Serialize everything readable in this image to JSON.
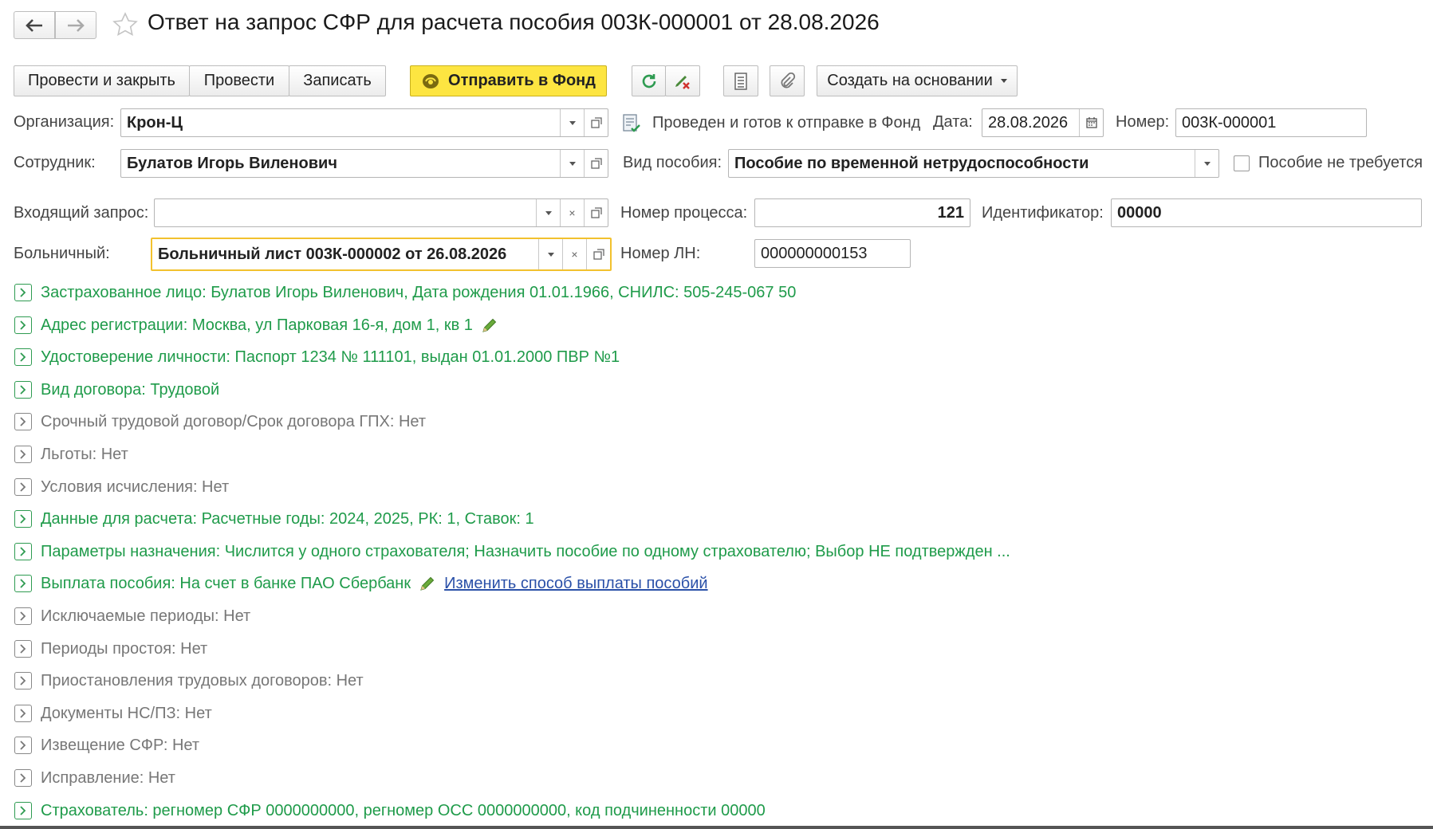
{
  "title": "Ответ на запрос СФР для расчета пособия 003К-000001 от 28.08.2026",
  "toolbar": {
    "post_close": "Провести и закрыть",
    "post": "Провести",
    "write": "Записать",
    "send": "Отправить в Фонд",
    "create_based": "Создать на основании"
  },
  "form": {
    "org_label": "Организация:",
    "org_value": "Крон-Ц",
    "status_text": "Проведен и готов к отправке в Фонд",
    "date_label": "Дата:",
    "date_value": "28.08.2026",
    "number_label": "Номер:",
    "number_value": "003К-000001",
    "employee_label": "Сотрудник:",
    "employee_value": "Булатов Игорь Виленович",
    "benefit_label": "Вид пособия:",
    "benefit_value": "Пособие по временной нетрудоспособности",
    "no_benefit_label": "Пособие не требуется",
    "request_label": "Входящий запрос:",
    "request_value": "",
    "process_label": "Номер процесса:",
    "process_value": "121",
    "ident_label": "Идентификатор:",
    "ident_value": "00000",
    "sick_label": "Больничный:",
    "sick_value": "Больничный лист 003К-000002 от 26.08.2026",
    "ln_label": "Номер ЛН:",
    "ln_value": "000000000153"
  },
  "sections": [
    {
      "text": "Застрахованное лицо: Булатов Игорь Виленович, Дата рождения 01.01.1966, СНИЛС: 505-245-067 50",
      "style": "green"
    },
    {
      "text": "Адрес регистрации: Москва, ул Парковая 16-я, дом 1, кв 1",
      "style": "green"
    },
    {
      "text": "Удостоверение личности: Паспорт 1234 № 111101, выдан 01.01.2000 ПВР №1",
      "style": "green"
    },
    {
      "text": "Вид договора: Трудовой",
      "style": "green"
    },
    {
      "text": "Срочный трудовой договор/Срок договора ГПХ: Нет",
      "style": "gray"
    },
    {
      "text": "Льготы: Нет",
      "style": "gray"
    },
    {
      "text": "Условия исчисления: Нет",
      "style": "gray"
    },
    {
      "text": "Данные для расчета: Расчетные годы: 2024, 2025, РК: 1, Ставок: 1",
      "style": "green"
    },
    {
      "text": "Параметры назначения: Числится у одного страхователя; Назначить пособие по одному страхователю; Выбор НЕ подтвержден ...",
      "style": "green"
    },
    {
      "text": "Выплата пособия: На счет в банке ПАО Сбербанк",
      "style": "green"
    },
    {
      "text": "Исключаемые периоды: Нет",
      "style": "gray"
    },
    {
      "text": "Периоды простоя: Нет",
      "style": "gray"
    },
    {
      "text": "Приостановления трудовых договоров: Нет",
      "style": "gray"
    },
    {
      "text": "Документы НС/ПЗ: Нет",
      "style": "gray"
    },
    {
      "text": "Извещение СФР: Нет",
      "style": "gray"
    },
    {
      "text": "Исправление: Нет",
      "style": "gray"
    },
    {
      "text": "Страхователь: регномер СФР 0000000000, регномер ОСС 0000000000, код подчиненности 00000",
      "style": "green"
    }
  ],
  "payment_link": "Изменить способ выплаты пособий",
  "colors": {
    "accent": "#fde541",
    "green": "#1f9b4a",
    "link": "#2a50a8"
  }
}
